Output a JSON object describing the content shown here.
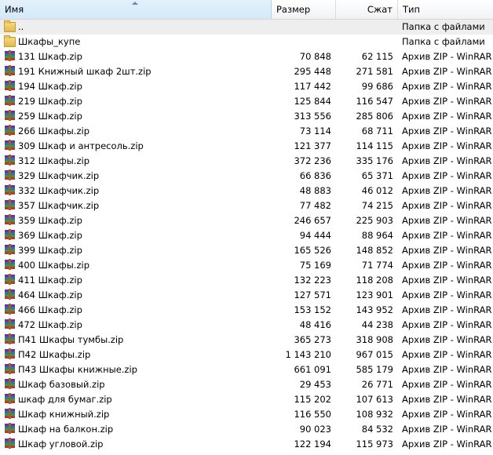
{
  "columns": {
    "name": "Имя",
    "size": "Размер",
    "packed": "Сжат",
    "type": "Тип"
  },
  "items": [
    {
      "name": "..",
      "size": "",
      "packed": "",
      "type": "Папка с файлами",
      "icon": "folder-icon",
      "selected": true
    },
    {
      "name": "Шкафы_купе",
      "size": "",
      "packed": "",
      "type": "Папка с файлами",
      "icon": "folder-icon"
    },
    {
      "name": "131 Шкаф.zip",
      "size": "70 848",
      "packed": "62 115",
      "type": "Архив ZIP - WinRAR",
      "icon": "winrar-archive-icon"
    },
    {
      "name": "191 Книжный шкаф 2шт.zip",
      "size": "295 448",
      "packed": "271 581",
      "type": "Архив ZIP - WinRAR",
      "icon": "winrar-archive-icon"
    },
    {
      "name": "194 Шкаф.zip",
      "size": "117 442",
      "packed": "99 686",
      "type": "Архив ZIP - WinRAR",
      "icon": "winrar-archive-icon"
    },
    {
      "name": "219 Шкаф.zip",
      "size": "125 844",
      "packed": "116 547",
      "type": "Архив ZIP - WinRAR",
      "icon": "winrar-archive-icon"
    },
    {
      "name": "259 Шкаф.zip",
      "size": "313 556",
      "packed": "285 806",
      "type": "Архив ZIP - WinRAR",
      "icon": "winrar-archive-icon"
    },
    {
      "name": "266 Шкафы.zip",
      "size": "73 114",
      "packed": "68 711",
      "type": "Архив ZIP - WinRAR",
      "icon": "winrar-archive-icon"
    },
    {
      "name": "309 Шкаф и антресоль.zip",
      "size": "121 377",
      "packed": "114 115",
      "type": "Архив ZIP - WinRAR",
      "icon": "winrar-archive-icon"
    },
    {
      "name": "312 Шкафы.zip",
      "size": "372 236",
      "packed": "335 176",
      "type": "Архив ZIP - WinRAR",
      "icon": "winrar-archive-icon"
    },
    {
      "name": "329 Шкафчик.zip",
      "size": "66 836",
      "packed": "65 371",
      "type": "Архив ZIP - WinRAR",
      "icon": "winrar-archive-icon"
    },
    {
      "name": "332 Шкафчик.zip",
      "size": "48 883",
      "packed": "46 012",
      "type": "Архив ZIP - WinRAR",
      "icon": "winrar-archive-icon"
    },
    {
      "name": "357 Шкафчик.zip",
      "size": "77 482",
      "packed": "74 215",
      "type": "Архив ZIP - WinRAR",
      "icon": "winrar-archive-icon"
    },
    {
      "name": "359 Шкаф.zip",
      "size": "246 657",
      "packed": "225 903",
      "type": "Архив ZIP - WinRAR",
      "icon": "winrar-archive-icon"
    },
    {
      "name": "369 Шкаф.zip",
      "size": "94 444",
      "packed": "88 964",
      "type": "Архив ZIP - WinRAR",
      "icon": "winrar-archive-icon"
    },
    {
      "name": "399 Шкаф.zip",
      "size": "165 526",
      "packed": "148 852",
      "type": "Архив ZIP - WinRAR",
      "icon": "winrar-archive-icon"
    },
    {
      "name": "400 Шкафы.zip",
      "size": "75 169",
      "packed": "71 774",
      "type": "Архив ZIP - WinRAR",
      "icon": "winrar-archive-icon"
    },
    {
      "name": "411 Шкаф.zip",
      "size": "132 223",
      "packed": "118 208",
      "type": "Архив ZIP - WinRAR",
      "icon": "winrar-archive-icon"
    },
    {
      "name": "464 Шкаф.zip",
      "size": "127 571",
      "packed": "123 901",
      "type": "Архив ZIP - WinRAR",
      "icon": "winrar-archive-icon"
    },
    {
      "name": "466 Шкаф.zip",
      "size": "153 152",
      "packed": "143 952",
      "type": "Архив ZIP - WinRAR",
      "icon": "winrar-archive-icon"
    },
    {
      "name": "472 Шкаф.zip",
      "size": "48 416",
      "packed": "44 238",
      "type": "Архив ZIP - WinRAR",
      "icon": "winrar-archive-icon"
    },
    {
      "name": "П41 Шкафы тумбы.zip",
      "size": "365 273",
      "packed": "318 908",
      "type": "Архив ZIP - WinRAR",
      "icon": "winrar-archive-icon"
    },
    {
      "name": "П42 Шкафы.zip",
      "size": "1 143 210",
      "packed": "967 015",
      "type": "Архив ZIP - WinRAR",
      "icon": "winrar-archive-icon"
    },
    {
      "name": "П43 Шкафы книжные.zip",
      "size": "661 091",
      "packed": "585 179",
      "type": "Архив ZIP - WinRAR",
      "icon": "winrar-archive-icon"
    },
    {
      "name": "Шкаф базовый.zip",
      "size": "29 453",
      "packed": "26 771",
      "type": "Архив ZIP - WinRAR",
      "icon": "winrar-archive-icon"
    },
    {
      "name": "шкаф для бумаг.zip",
      "size": "115 202",
      "packed": "107 613",
      "type": "Архив ZIP - WinRAR",
      "icon": "winrar-archive-icon"
    },
    {
      "name": "Шкаф книжный.zip",
      "size": "116 550",
      "packed": "108 932",
      "type": "Архив ZIP - WinRAR",
      "icon": "winrar-archive-icon"
    },
    {
      "name": "Шкаф на балкон.zip",
      "size": "90 023",
      "packed": "84 532",
      "type": "Архив ZIP - WinRAR",
      "icon": "winrar-archive-icon"
    },
    {
      "name": "Шкаф угловой.zip",
      "size": "122 194",
      "packed": "115 973",
      "type": "Архив ZIP - WinRAR",
      "icon": "winrar-archive-icon"
    }
  ]
}
